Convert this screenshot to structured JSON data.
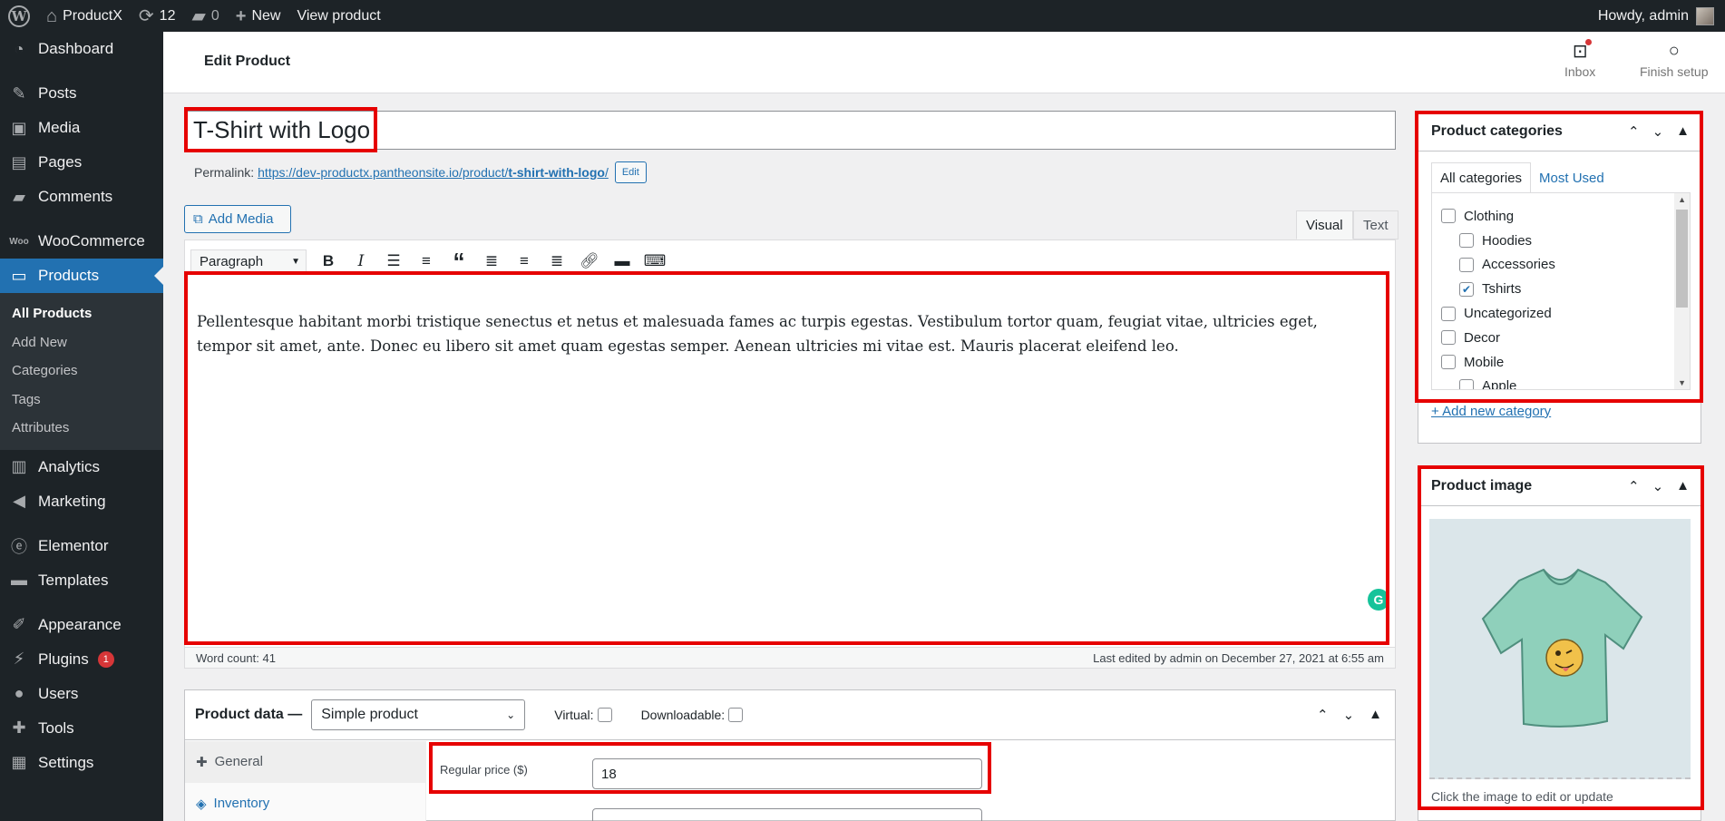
{
  "adminbar": {
    "site_name": "ProductX",
    "updates_count": "12",
    "comments_count": "0",
    "new_label": "New",
    "view_label": "View product",
    "howdy": "Howdy, admin"
  },
  "sidebar": {
    "dashboard": "Dashboard",
    "posts": "Posts",
    "media": "Media",
    "pages": "Pages",
    "comments": "Comments",
    "woocommerce": "WooCommerce",
    "products": "Products",
    "sub_all": "All Products",
    "sub_add": "Add New",
    "sub_categories": "Categories",
    "sub_tags": "Tags",
    "sub_attributes": "Attributes",
    "analytics": "Analytics",
    "marketing": "Marketing",
    "elementor": "Elementor",
    "templates": "Templates",
    "appearance": "Appearance",
    "plugins": "Plugins",
    "plugins_badge": "1",
    "users": "Users",
    "tools": "Tools",
    "settings": "Settings"
  },
  "header": {
    "title": "Edit Product",
    "inbox": "Inbox",
    "finish_setup": "Finish setup"
  },
  "editor": {
    "title_value": "T-Shirt with Logo",
    "permalink_label": "Permalink:",
    "permalink_base": "https://dev-productx.pantheonsite.io/product/",
    "permalink_slug": "t-shirt-with-logo",
    "permalink_end": "/",
    "edit_btn": "Edit",
    "add_media": "Add Media",
    "tab_visual": "Visual",
    "tab_text": "Text",
    "format": "Paragraph",
    "content": "Pellentesque habitant morbi tristique senectus et netus et malesuada fames ac turpis egestas. Vestibulum tortor quam, feugiat vitae, ultricies eget, tempor sit amet, ante. Donec eu libero sit amet quam egestas semper. Aenean ultricies mi vitae est. Mauris placerat eleifend leo.",
    "word_count": "Word count: 41",
    "last_edited": "Last edited by admin on December 27, 2021 at 6:55 am"
  },
  "product_data": {
    "title": "Product data —",
    "type": "Simple product",
    "virtual": "Virtual:",
    "downloadable": "Downloadable:",
    "tab_general": "General",
    "tab_inventory": "Inventory",
    "regular_price_label": "Regular price ($)",
    "regular_price": "18"
  },
  "categories_box": {
    "title": "Product categories",
    "tab_all": "All categories",
    "tab_most_used": "Most Used",
    "items": [
      {
        "label": "Clothing",
        "checked": false,
        "child": false
      },
      {
        "label": "Hoodies",
        "checked": false,
        "child": true
      },
      {
        "label": "Accessories",
        "checked": false,
        "child": true
      },
      {
        "label": "Tshirts",
        "checked": true,
        "child": true
      },
      {
        "label": "Uncategorized",
        "checked": false,
        "child": false
      },
      {
        "label": "Decor",
        "checked": false,
        "child": false
      },
      {
        "label": "Mobile",
        "checked": false,
        "child": false
      },
      {
        "label": "Apple",
        "checked": false,
        "child": true
      }
    ],
    "add_new": "+ Add new category"
  },
  "image_box": {
    "title": "Product image",
    "caption": "Click the image to edit or update"
  },
  "colors": {
    "highlight": "#e60000",
    "accent": "#2271b1",
    "adminbar": "#1d2327"
  }
}
